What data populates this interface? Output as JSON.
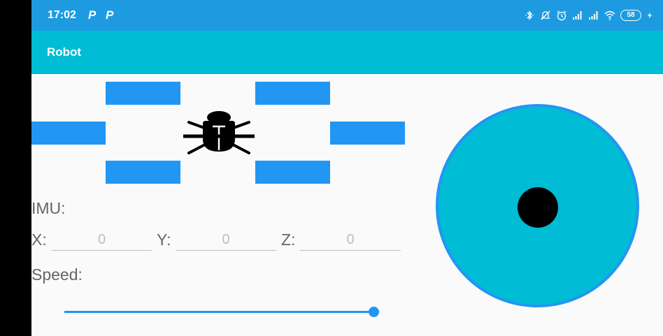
{
  "status_bar": {
    "time": "17:02",
    "notification_1": "P",
    "notification_2": "P",
    "battery_level": "58",
    "icons": [
      "bluetooth-icon",
      "mute-icon",
      "alarm-icon",
      "signal-icon",
      "signal-icon",
      "wifi-icon",
      "battery-icon",
      "charging-icon"
    ]
  },
  "app_bar": {
    "title": "Robot"
  },
  "controls": {
    "icon": "bug-icon"
  },
  "imu": {
    "label": "IMU:",
    "x_label": "X:",
    "x_value": "0",
    "y_label": "Y:",
    "y_value": "0",
    "z_label": "Z:",
    "z_value": "0"
  },
  "speed": {
    "label": "Speed:",
    "value_fraction": 1.0
  },
  "joystick": {
    "knob_x": 0,
    "knob_y": 0
  },
  "colors": {
    "status_bar": "#1e9be0",
    "app_bar": "#00bcd4",
    "button": "#2196f3",
    "joystick_fill": "#00bcd4",
    "joystick_border": "#2196f3",
    "knob": "#000000"
  }
}
